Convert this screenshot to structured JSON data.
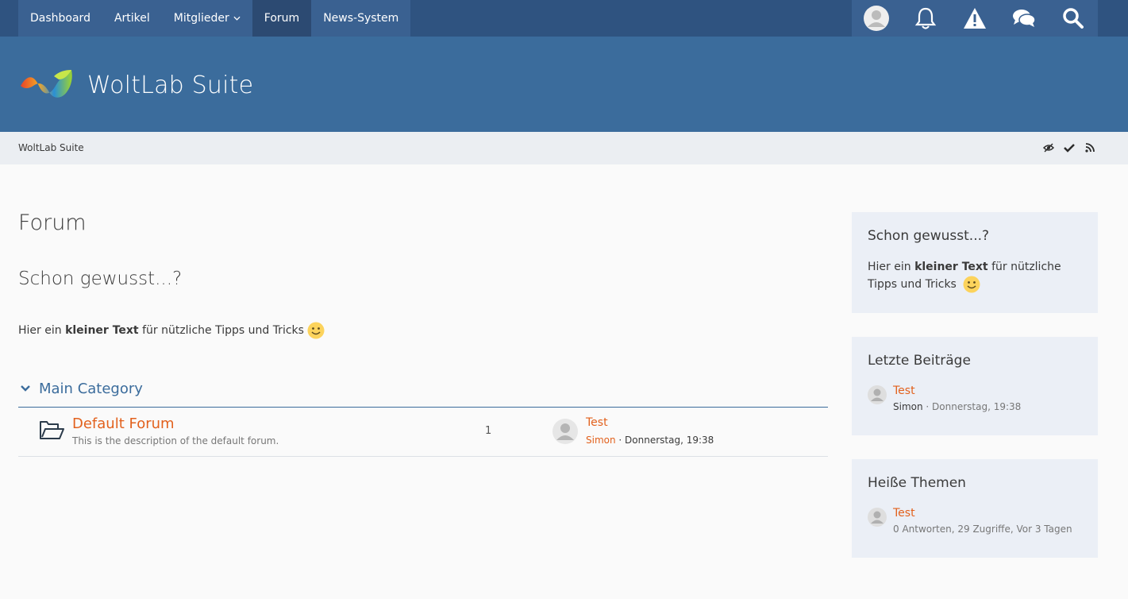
{
  "nav": {
    "items": [
      {
        "label": "Dashboard"
      },
      {
        "label": "Artikel"
      },
      {
        "label": "Mitglieder"
      },
      {
        "label": "Forum"
      },
      {
        "label": "News-System"
      }
    ]
  },
  "header": {
    "logo_text": "WoltLab Suite"
  },
  "breadcrumb": {
    "label": "WoltLab Suite"
  },
  "main": {
    "page_title": "Forum",
    "tip_heading": "Schon gewusst...?",
    "tip_pre": "Hier ein ",
    "tip_bold": "kleiner Text",
    "tip_post": " für nützliche Tipps und Tricks",
    "category": {
      "title": "Main Category"
    },
    "forum": {
      "title": "Default Forum",
      "description": "This is the description of the default forum.",
      "count": "1",
      "last_post_title": "Test",
      "last_post_author": "Simon",
      "last_post_sep": " · ",
      "last_post_time": "Donnerstag, 19:38"
    }
  },
  "sidebar": {
    "tip_box": {
      "title": "Schon gewusst...?",
      "pre": "Hier ein ",
      "bold": "kleiner Text",
      "post": " für nützliche Tipps und Tricks"
    },
    "recent_posts": {
      "title": "Letzte Beiträge",
      "entry_title": "Test",
      "entry_author": "Simon",
      "entry_meta": " · Donnerstag, 19:38"
    },
    "hot_topics": {
      "title": "Heiße Themen",
      "entry_title": "Test",
      "entry_meta": "0 Antworten, 29 Zugriffe, Vor 3 Tagen"
    }
  },
  "colors": {
    "topbar": "#2f5380",
    "header": "#3b6c9c",
    "link_accent": "#e2611d",
    "category": "#3b6c9c",
    "sidebar_box": "#ebeff6"
  }
}
